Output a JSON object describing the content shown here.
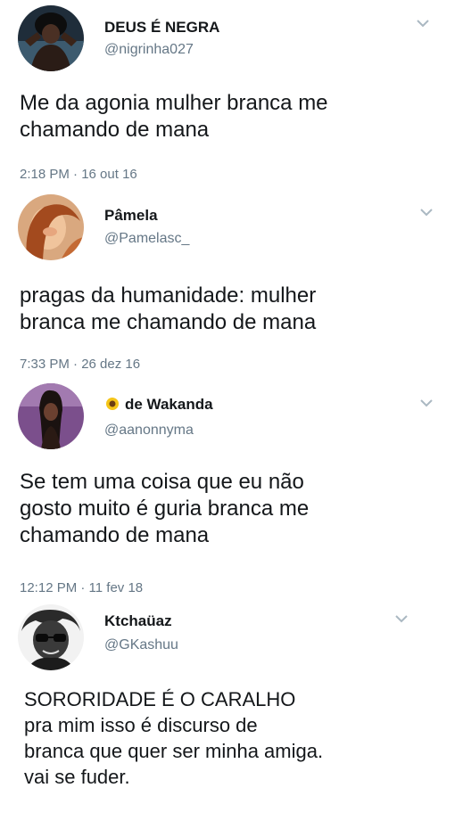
{
  "tweets": [
    {
      "name": "DEUS É NEGRA",
      "handle": "@nigrinha027",
      "text": "Me da agonia mulher branca me\nchamando de mana",
      "timestamp": "2:18 PM · 16 out 16"
    },
    {
      "name": "Pâmela",
      "handle": "@Pamelasc_",
      "text": "pragas da humanidade: mulher\nbranca me chamando de mana",
      "timestamp": "7:33 PM · 26 dez 16"
    },
    {
      "name": "de Wakanda",
      "handle": "@aanonnyma",
      "name_badge": "sunflower-icon",
      "text": "Se tem uma coisa que eu não\ngosto muito é guria branca me\nchamando de mana",
      "timestamp": "12:12 PM · 11 fev 18"
    },
    {
      "name": "Ktchaüaz",
      "handle": "@GKashuu",
      "text": "SORORIDADE É O CARALHO\npra mim isso é discurso de\nbranca que quer ser minha amiga.\nvai se fuder."
    }
  ],
  "colors": {
    "text": "#14171a",
    "secondary": "#657786",
    "chevron": "#aab8c2"
  }
}
